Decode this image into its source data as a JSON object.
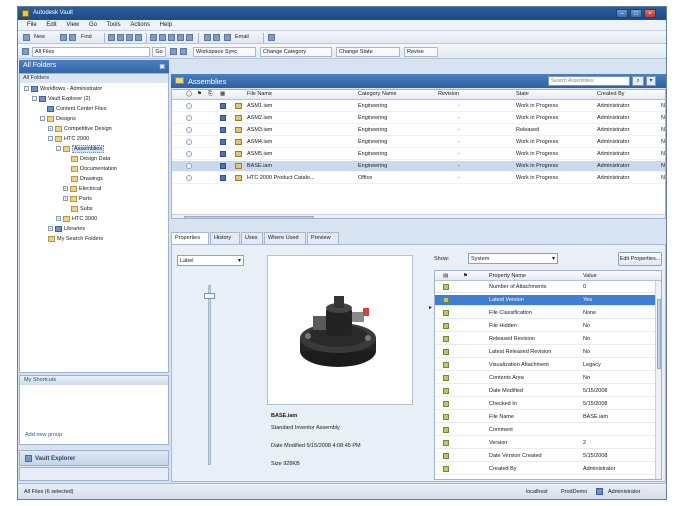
{
  "window": {
    "title": "Autodesk Vault"
  },
  "menu": [
    "File",
    "Edit",
    "View",
    "Go",
    "Tools",
    "Actions",
    "Help"
  ],
  "toolbar": {
    "new_label": "New",
    "find_label": "Find",
    "goto_label": "Go",
    "address_value": "All Files",
    "workspace_sync_label": "Workspace Sync",
    "change_category_label": "Change Category",
    "change_state_label": "Change State",
    "revise_label": "Revise",
    "email_label": "Email"
  },
  "sidebar": {
    "title": "All Folders",
    "root_label": "All Folders",
    "items": [
      {
        "label": "Workflows - Administrator"
      },
      {
        "label": "Vault Explorer (2)"
      },
      {
        "label": "Content Center Files"
      },
      {
        "label": "Designs"
      },
      {
        "label": "Competitive Design"
      },
      {
        "label": "HTC 2000"
      },
      {
        "label": "Assemblies"
      },
      {
        "label": "Design Data"
      },
      {
        "label": "Documentation"
      },
      {
        "label": "Drawings"
      },
      {
        "label": "Electrical"
      },
      {
        "label": "Parts"
      },
      {
        "label": "Subs"
      },
      {
        "label": "HTC 3000"
      },
      {
        "label": "Libraries"
      },
      {
        "label": "My Search Folders"
      }
    ],
    "panel2_title": "My Shortcuts",
    "add_group_label": "Add new group",
    "vault_explorer_label": "Vault Explorer"
  },
  "main": {
    "title": "Assemblies",
    "search_placeholder": "Search Assemblies",
    "columns": [
      "File Name",
      "Category Name",
      "Revision",
      "State",
      "Created By"
    ],
    "rows": [
      {
        "file": "ASM1.iam",
        "category": "Engineering",
        "revision": "-",
        "state": "Work in Progress",
        "created_by": "Administrator",
        "extra": "N"
      },
      {
        "file": "ASM2.iam",
        "category": "Engineering",
        "revision": "-",
        "state": "Work in Progress",
        "created_by": "Administrator",
        "extra": "N"
      },
      {
        "file": "ASM3.iam",
        "category": "Engineering",
        "revision": "-",
        "state": "Released",
        "created_by": "Administrator",
        "extra": "N"
      },
      {
        "file": "ASM4.iam",
        "category": "Engineering",
        "revision": "-",
        "state": "Work in Progress",
        "created_by": "Administrator",
        "extra": "N"
      },
      {
        "file": "ASM5.iam",
        "category": "Engineering",
        "revision": "-",
        "state": "Work in Progress",
        "created_by": "Administrator",
        "extra": "N"
      },
      {
        "file": "BASE.iam",
        "category": "Engineering",
        "revision": "-",
        "state": "Work in Progress",
        "created_by": "Administrator",
        "extra": "N"
      },
      {
        "file": "HTC 2000 Product Catalo...",
        "category": "Office",
        "revision": "-",
        "state": "Work in Progress",
        "created_by": "Administrator",
        "extra": "N"
      }
    ],
    "selected_row_index": 5
  },
  "tabs": [
    "Properties",
    "History",
    "Uses",
    "Where Used",
    "Preview"
  ],
  "detail": {
    "zoom_value": "Label",
    "show_label": "Show:",
    "show_value": "System",
    "edit_button": "Edit Properties...",
    "info_title": "BASE.iam",
    "info_desc": "Standard Inventor Assembly",
    "info_modified": "Date Modified 5/15/2008 4:08:45 PM",
    "info_size": "Size 928KB",
    "prop_columns": [
      "Property Name",
      "Value"
    ],
    "properties": [
      {
        "name": "Number of Attachments",
        "value": "0"
      },
      {
        "name": "Latest Version",
        "value": "Yes"
      },
      {
        "name": "File Classification",
        "value": "None"
      },
      {
        "name": "File Hidden",
        "value": "No"
      },
      {
        "name": "Released Revision",
        "value": "No"
      },
      {
        "name": "Latest Released Revision",
        "value": "No"
      },
      {
        "name": "Visualization Attachment",
        "value": "Legacy"
      },
      {
        "name": "Contents Area",
        "value": "No"
      },
      {
        "name": "Date Modified",
        "value": "5/15/2008"
      },
      {
        "name": "Checked In",
        "value": "5/15/2008"
      },
      {
        "name": "File Name",
        "value": "BASE.iam"
      },
      {
        "name": "Comment",
        "value": ""
      },
      {
        "name": "Version",
        "value": "2"
      },
      {
        "name": "Date Version Created",
        "value": "5/15/2008"
      },
      {
        "name": "Created By",
        "value": "Administrator"
      }
    ],
    "highlighted_property_index": 1
  },
  "status": {
    "left": "All Files (6 selected)",
    "right1": "localhost",
    "right2": "ProdDemo",
    "right3": "Administrator"
  }
}
